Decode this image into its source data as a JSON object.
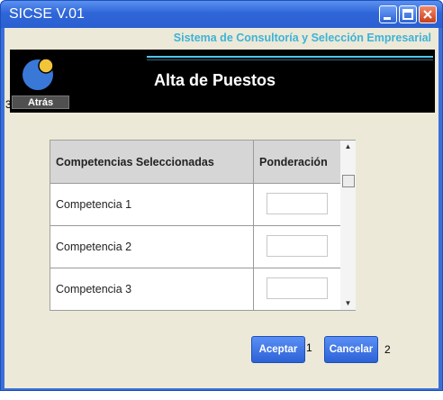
{
  "window": {
    "title": "SICSE V.01",
    "controls": [
      "minimize-icon",
      "maximize-icon",
      "close-icon"
    ]
  },
  "header": {
    "subtitle": "Sistema de Consultoría y Selección Empresarial",
    "page_title": "Alta de Puestos",
    "back_label": "Atrás",
    "logo": "circle-logo-icon"
  },
  "grid": {
    "columns": [
      "Competencias Seleccionadas",
      "Ponderación"
    ],
    "rows": [
      {
        "competencia": "Competencia 1",
        "ponderacion": ""
      },
      {
        "competencia": "Competencia 2",
        "ponderacion": ""
      },
      {
        "competencia": "Competencia 3",
        "ponderacion": ""
      }
    ]
  },
  "actions": {
    "accept_label": "Aceptar",
    "cancel_label": "Cancelar"
  },
  "markers": {
    "back": "3",
    "accept": "1",
    "cancel": "2"
  },
  "colors": {
    "titlebar": "#2f66d8",
    "subtitle": "#3fb2d6",
    "banner": "#000000",
    "button": "#3a70e0"
  }
}
